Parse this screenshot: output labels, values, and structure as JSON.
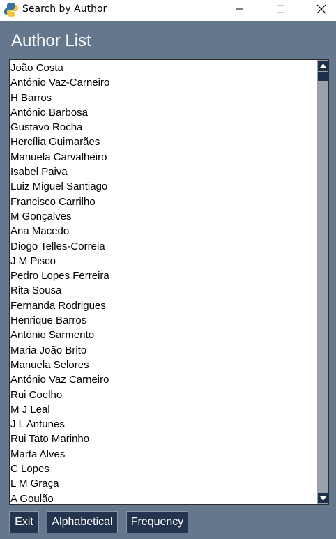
{
  "window": {
    "title": "Search by Author"
  },
  "heading": "Author List",
  "authors": [
    "João Costa",
    "António Vaz-Carneiro",
    "H Barros",
    "António Barbosa",
    "Gustavo Rocha",
    "Hercília Guimarães",
    "Manuela Carvalheiro",
    "Isabel Paiva",
    "Luiz Miguel Santiago",
    "Francisco Carrilho",
    "M Gonçalves",
    "Ana Macedo",
    "Diogo Telles-Correia",
    "J M Pisco",
    "Pedro Lopes Ferreira",
    "Rita Sousa",
    "Fernanda Rodrigues",
    "Henrique Barros",
    "António Sarmento",
    "Maria João Brito",
    "Manuela Selores",
    "António Vaz Carneiro",
    "Rui Coelho",
    "M J Leal",
    "J L Antunes",
    "Rui Tato Marinho",
    "Marta Alves",
    "C Lopes",
    "L M Graça",
    "A Goulão"
  ],
  "buttons": {
    "exit": "Exit",
    "alphabetical": "Alphabetical",
    "frequency": "Frequency"
  },
  "colors": {
    "background": "#64778d",
    "button": "#24344f",
    "scrollbar_track": "#9aa1ab",
    "scrollbar_thumb": "#1d2f4a"
  },
  "icons": {
    "app": "python-icon",
    "minimize": "minimize-icon",
    "maximize": "maximize-icon",
    "close": "close-icon",
    "scroll_up": "arrow-up-icon",
    "scroll_down": "arrow-down-icon"
  }
}
